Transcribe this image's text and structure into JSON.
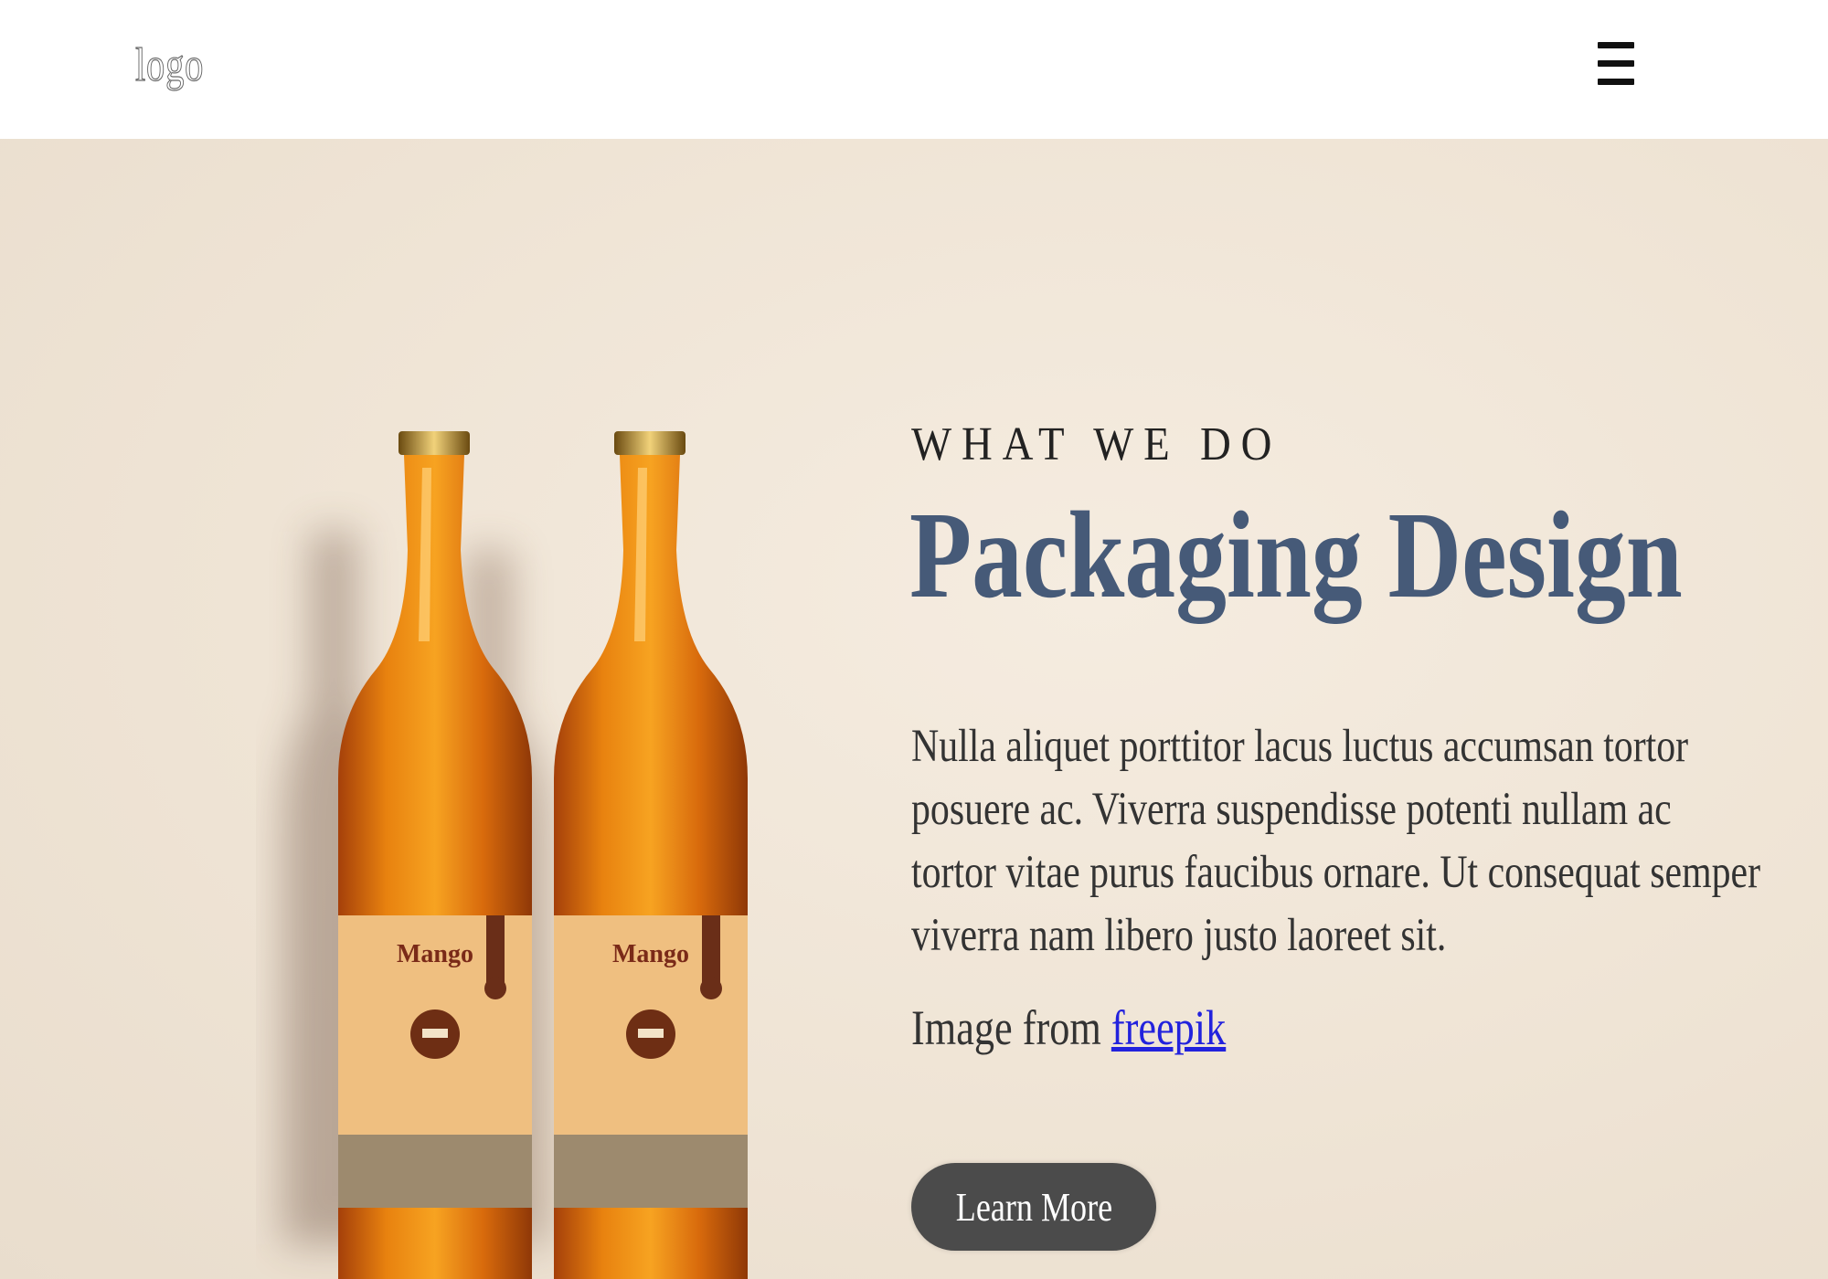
{
  "header": {
    "logo_text": "logo",
    "menu_icon": "hamburger-menu-icon"
  },
  "hero": {
    "kicker": "WHAT WE DO",
    "title": "Packaging Design",
    "body": "Nulla aliquet porttitor lacus luctus accumsan tortor posuere ac. Viverra suspendisse potenti nullam ac tortor vitae purus faucibus ornare. Ut consequat semper viverra nam libero justo laoreet sit.",
    "credit_prefix": "Image from",
    "credit_link": "freepik",
    "cta_label": "Learn More",
    "bottle_label_text": "Mango"
  },
  "colors": {
    "background": "#efe4d5",
    "title": "#465a78",
    "button": "#4b4b4b",
    "link": "#2222dd",
    "bottle_amber": "#e08a10",
    "label": "#efbf80"
  }
}
